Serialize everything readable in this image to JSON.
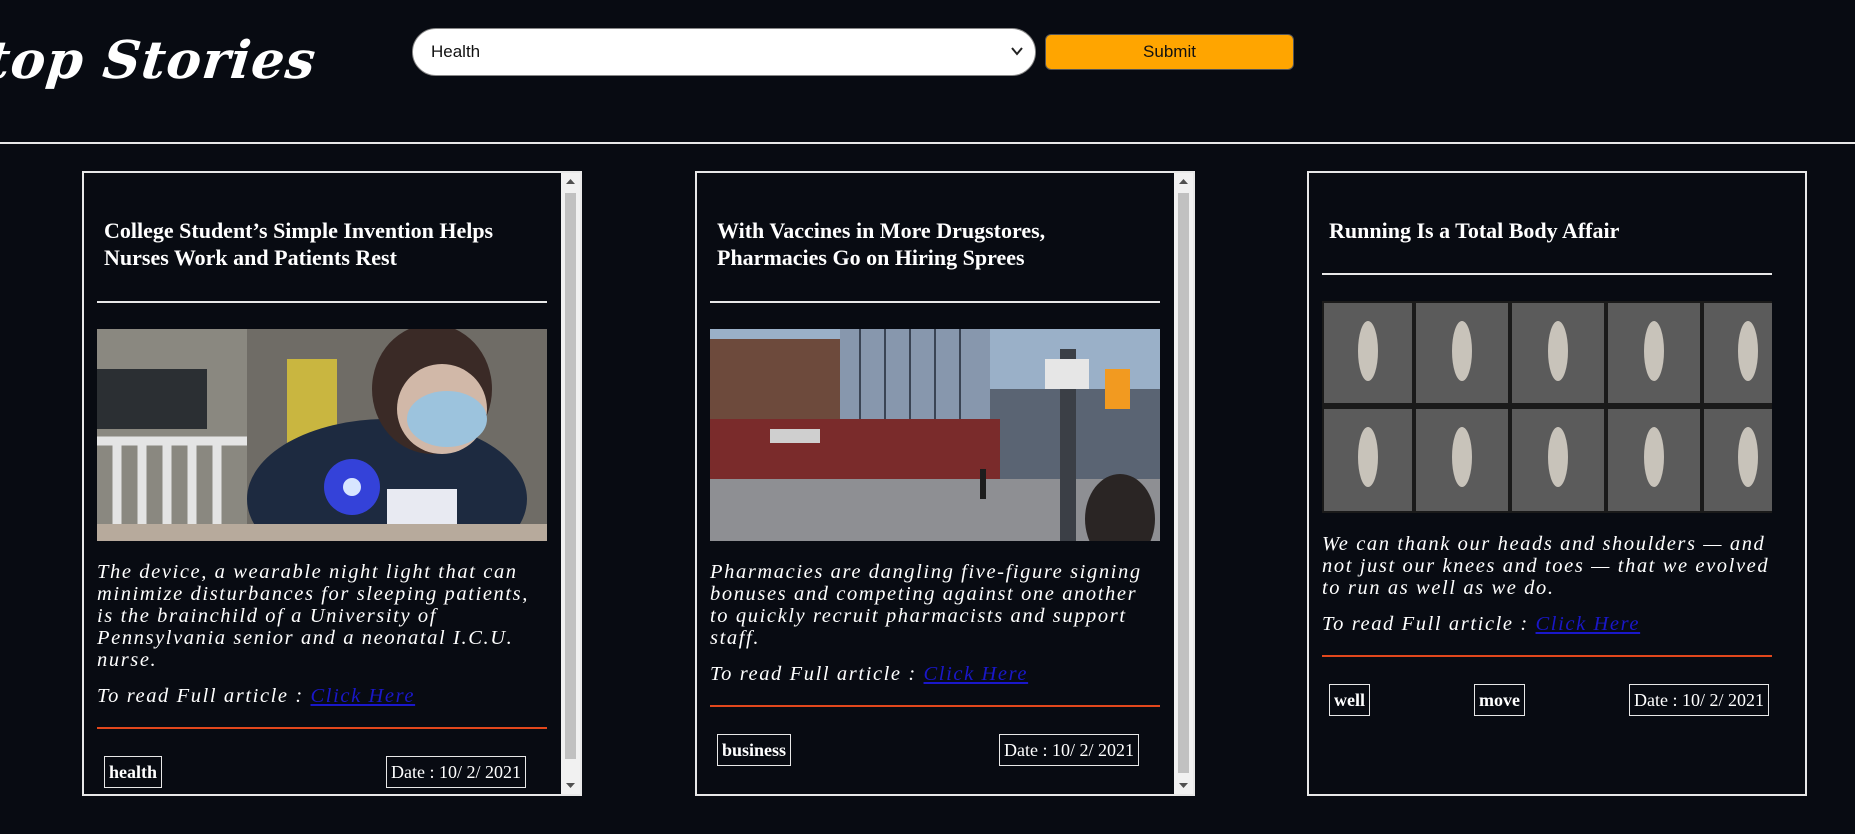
{
  "header": {
    "title": "top Stories",
    "category_select": {
      "selected": "Health"
    },
    "submit_label": "Submit"
  },
  "cards": [
    {
      "title": "College Student’s Simple Invention Helps Nurses Work and Patients Rest",
      "image_desc_icon": "photo-nurse-night-light",
      "abstract": "The device, a wearable night light that can minimize disturbances for sleeping patients, is the brainchild of a University of Pennsylvania senior and a neonatal I.C.U. nurse.",
      "read_prefix": "To read Full article : ",
      "read_link": "Click Here",
      "tags": [
        "health"
      ],
      "date": "Date : 10/ 2/ 2021"
    },
    {
      "title": "With Vaccines in More Drugstores, Pharmacies Go on Hiring Sprees",
      "image_desc_icon": "photo-pharmacy-street",
      "abstract": "Pharmacies are dangling five-figure signing bonuses and competing against one another to quickly recruit pharmacists and support staff.",
      "read_prefix": "To read Full article : ",
      "read_link": "Click Here",
      "tags": [
        "business"
      ],
      "date": "Date : 10/ 2/ 2021"
    },
    {
      "title": "Running Is a Total Body Affair",
      "image_desc_icon": "photo-runner-sequence",
      "abstract": "We can thank our heads and shoulders — and not just our knees and toes — that we evolved to run as well as we do.",
      "read_prefix": "To read Full article : ",
      "read_link": "Click Here",
      "tags": [
        "well",
        "move"
      ],
      "date": "Date : 10/ 2/ 2021"
    }
  ],
  "colors": {
    "background": "#080b12",
    "accent_button": "#ffa500",
    "divider_red": "#e2471c",
    "link": "#1a17c9"
  }
}
